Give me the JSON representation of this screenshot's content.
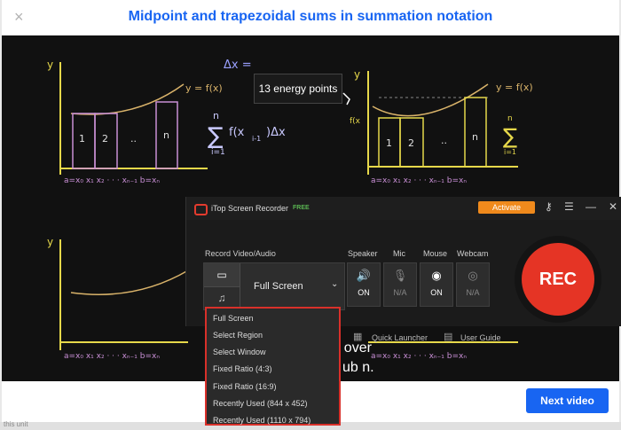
{
  "modal": {
    "title": "Midpoint and trapezoidal sums in summation notation",
    "close_icon": "×",
    "tooltip": "13 energy points",
    "next_button": "Next video",
    "captions": [
      "nt over",
      "ub n."
    ]
  },
  "recorder": {
    "app_name": "iTop Screen Recorder",
    "badge": "FREE",
    "activate_label": "Activate",
    "section_label": "Record Video/Audio",
    "mode_value": "Full Screen",
    "devices": [
      {
        "label": "Speaker",
        "status": "ON",
        "icon": "speaker-icon"
      },
      {
        "label": "Mic",
        "status": "N/A",
        "icon": "mic-icon"
      },
      {
        "label": "Mouse",
        "status": "ON",
        "icon": "mouse-icon"
      },
      {
        "label": "Webcam",
        "status": "N/A",
        "icon": "webcam-icon"
      }
    ],
    "rec_label": "REC",
    "quick_launcher": "Quick Launcher",
    "user_guide": "User Guide"
  },
  "dropdown": {
    "items": [
      "Full Screen",
      "Select Region",
      "Select Window",
      "Fixed Ratio (4:3)",
      "Fixed Ratio (16:9)",
      "Recently Used (844 x 452)",
      "Recently Used (1110 x 794)"
    ]
  },
  "video_math": {
    "left_top": {
      "y": "y",
      "fx": "y = f(x)",
      "sum_top": "n",
      "sum_expr": "f(x",
      "sum_sub": "i-1",
      "sum_end": ")Δx",
      "sum_bot": "i=1",
      "bars": [
        "1",
        "2",
        "..",
        "n"
      ],
      "axis": "a=x₀  x₁     x₂ · · ·   xₙ₋₁ b=xₙ",
      "dx": "Δx = ",
      "dx_den": "n"
    },
    "right_top": {
      "y": "y",
      "fx": "y = f(x)",
      "f0": "f(x",
      "bars": [
        "1",
        "2",
        "..",
        "n"
      ],
      "axis": "a=x₀  x₁     x₂ · · ·   xₙ₋₁ b=xₙ",
      "sum_top": "n",
      "sum_bot": "i=1"
    },
    "left_bottom": {
      "y": "y",
      "axis": "a=x₀  x₁     x₂ · · ·   xₙ₋₁ b=xₙ"
    },
    "right_bottom": {
      "axis": "a=x₀  x₁     x₂ · · ·   xₙ₋₁ b=xₙ"
    }
  },
  "page": {
    "bottom_text": "this unit"
  },
  "colors": {
    "accent": "#1865f2",
    "rec": "#e53425",
    "activate": "#f08a1c",
    "dropdown_border": "#d9302a",
    "axis": "#e6d84a",
    "curve": "#d9b36a",
    "bars": "#c98fd6"
  }
}
